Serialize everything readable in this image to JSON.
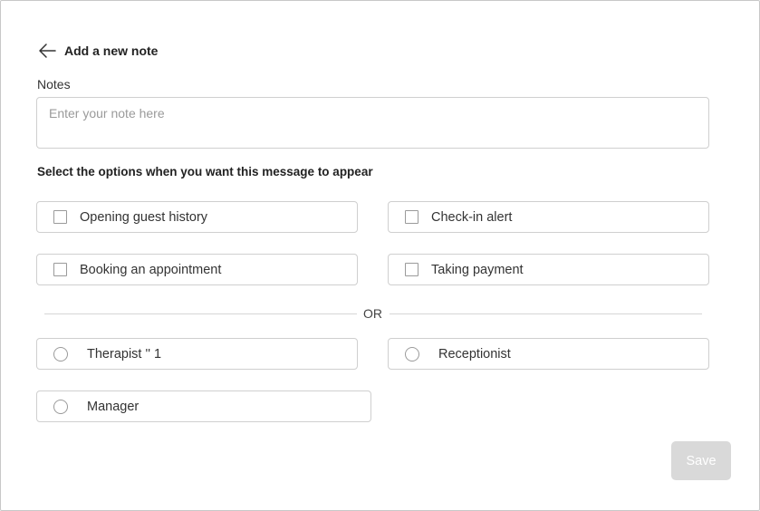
{
  "header": {
    "title": "Add a new note",
    "back_icon": "arrow-left-icon"
  },
  "notes": {
    "label": "Notes",
    "value": "",
    "placeholder": "Enter your note here"
  },
  "options_section": {
    "label": "Select the options when you want this message to appear",
    "checkboxes": [
      {
        "label": "Opening guest history",
        "checked": false
      },
      {
        "label": "Check-in alert",
        "checked": false
      },
      {
        "label": "Booking an appointment",
        "checked": false
      },
      {
        "label": "Taking payment",
        "checked": false
      }
    ],
    "divider_text": "OR",
    "radios": [
      {
        "label": "Therapist '' 1",
        "selected": false
      },
      {
        "label": "Receptionist",
        "selected": false
      },
      {
        "label": "Manager",
        "selected": false
      }
    ]
  },
  "actions": {
    "save_label": "Save",
    "save_disabled": true
  },
  "colors": {
    "border": "#cfcfcf",
    "save_disabled_bg": "#d9d9d9",
    "text": "#333333"
  }
}
